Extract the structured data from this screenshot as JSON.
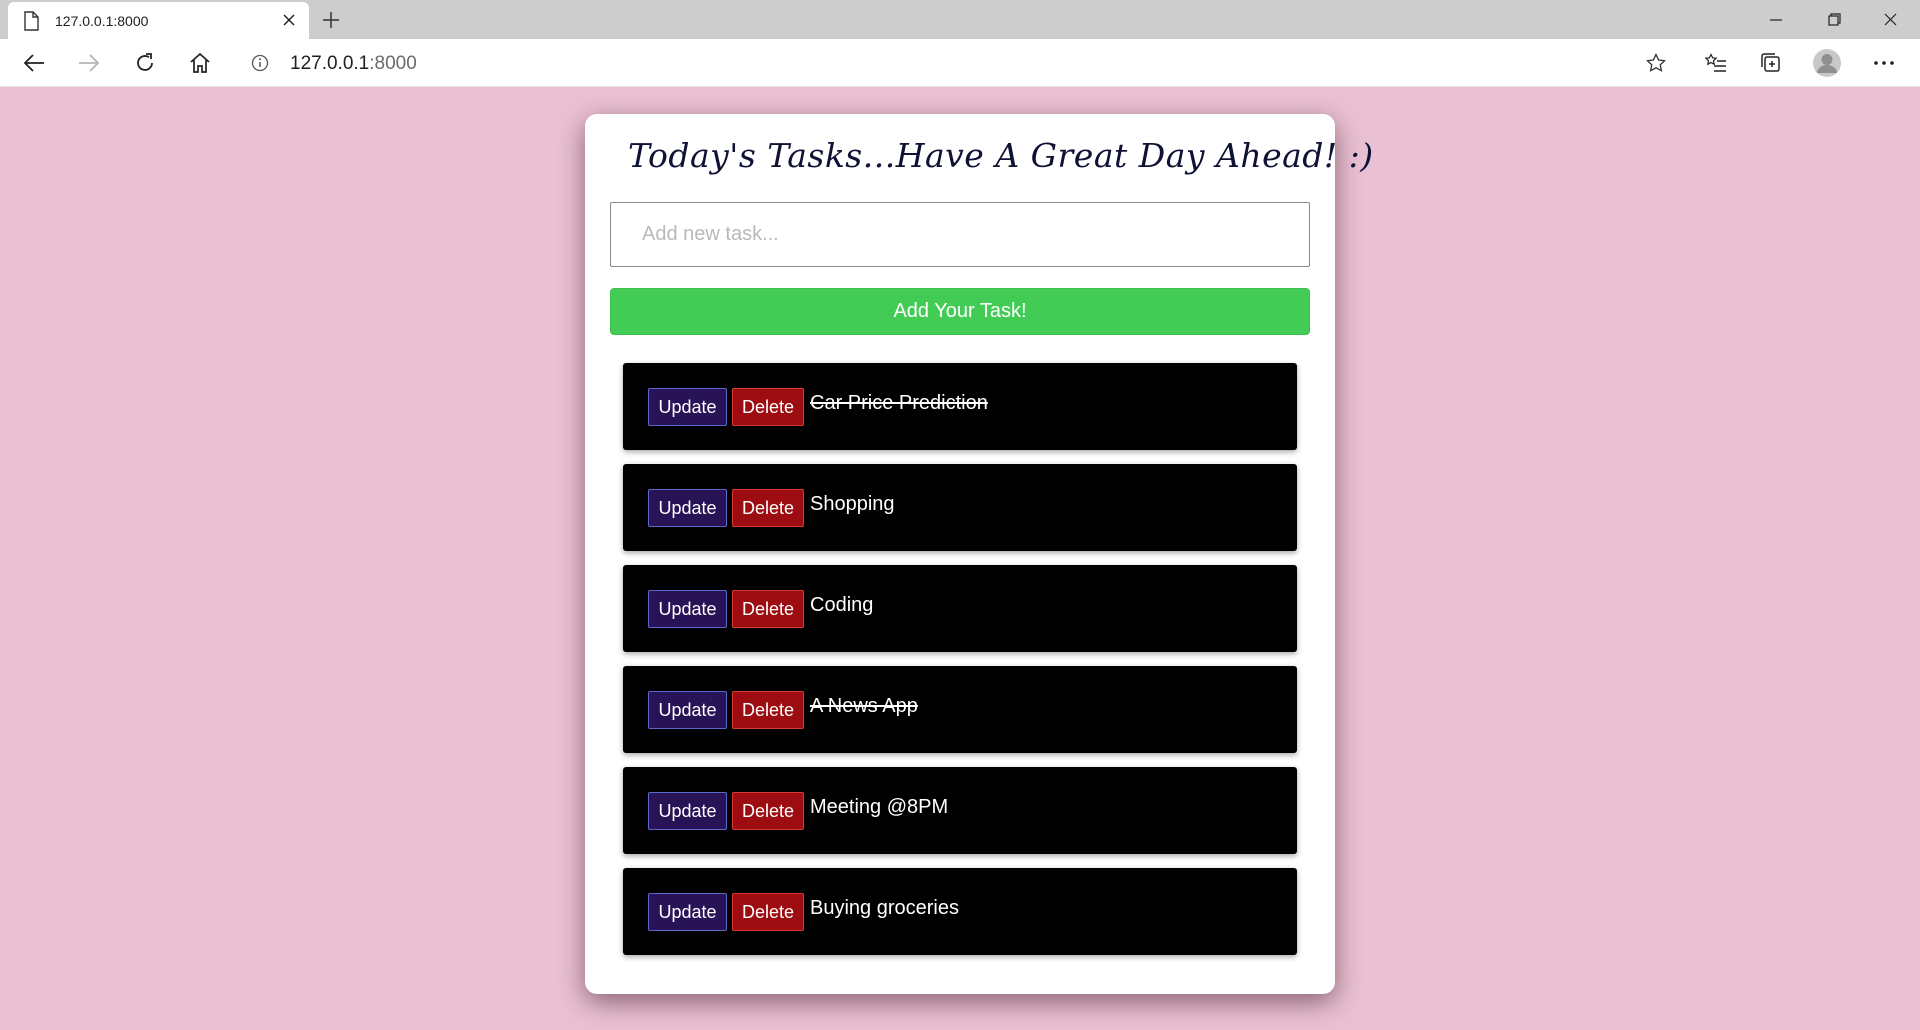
{
  "browser": {
    "tab_title": "127.0.0.1:8000",
    "url_host": "127.0.0.1",
    "url_port": ":8000"
  },
  "app": {
    "title": "Today's Tasks...Have A Great Day Ahead! :)",
    "input_placeholder": "Add new task...",
    "add_button_label": "Add Your Task!",
    "update_label": "Update",
    "delete_label": "Delete",
    "tasks": [
      {
        "text": "Car Price Prediction",
        "completed": true
      },
      {
        "text": "Shopping",
        "completed": false
      },
      {
        "text": "Coding",
        "completed": false
      },
      {
        "text": "A News App",
        "completed": true
      },
      {
        "text": "Meeting @8PM",
        "completed": false
      },
      {
        "text": "Buying groceries",
        "completed": false
      }
    ]
  },
  "colors": {
    "page_background": "#e9c1d2",
    "add_button": "#43cc55",
    "update_button": "#271356",
    "delete_button": "#9d0c10",
    "task_background": "#000000"
  }
}
